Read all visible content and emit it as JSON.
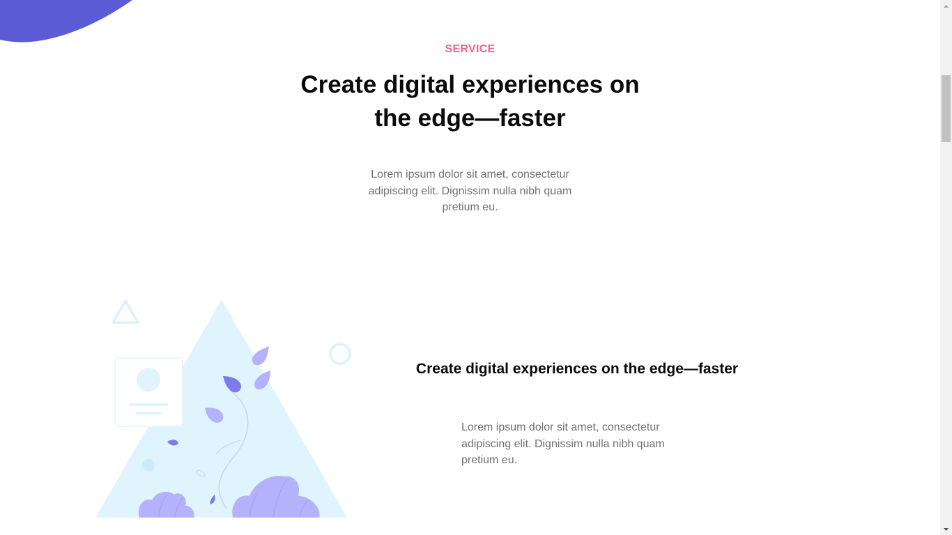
{
  "service_section": {
    "label": "SERVICE",
    "title": "Create digital experiences on the edge—faster",
    "description": "Lorem ipsum dolor sit amet, consectetur adipiscing elit. Dignissim nulla nibh quam pretium eu."
  },
  "feature": {
    "title": "Create digital experiences on the edge—faster",
    "description": "Lorem ipsum dolor sit amet, consectetur adipiscing elit. Dignissim nulla nibh quam pretium eu.",
    "illustration_icon": "plant-triangle-illustration"
  },
  "colors": {
    "accent_pink": "#f0648c",
    "brand_purple": "#5b5bd6",
    "light_blue": "#dff4fd",
    "leaf_purple": "#b4b2fb",
    "heading": "#0a0a0a",
    "body_text": "#6f6f6f"
  }
}
